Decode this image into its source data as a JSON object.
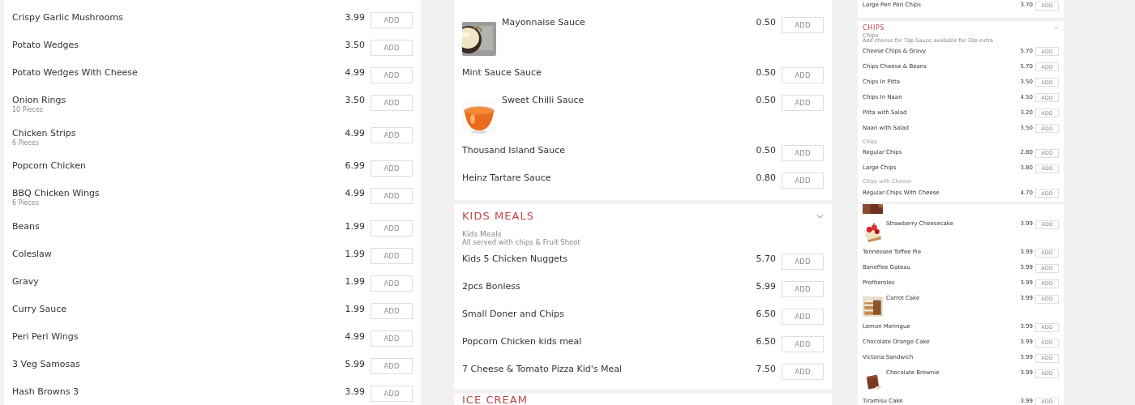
{
  "columns": [
    {
      "kind": "full",
      "sections": [
        {
          "items": [
            {
              "kind": "item",
              "name": "Crispy Garlic Mushrooms",
              "price": "3.99",
              "button": "ADD"
            },
            {
              "kind": "item",
              "name": "Potato Wedges",
              "price": "3.50",
              "button": "ADD"
            },
            {
              "kind": "item",
              "name": "Potato Wedges With Cheese",
              "price": "4.99",
              "button": "ADD"
            },
            {
              "kind": "item",
              "name": "Onion Rings",
              "sub": "10 Pieces",
              "price": "3.50",
              "button": "ADD"
            },
            {
              "kind": "item",
              "name": "Chicken Strips",
              "sub": "6 Pieces",
              "price": "4.99",
              "button": "ADD"
            },
            {
              "kind": "item",
              "name": "Popcorn Chicken",
              "price": "6.99",
              "button": "ADD"
            },
            {
              "kind": "item",
              "name": "BBQ Chicken Wings",
              "sub": "6 Pieces",
              "price": "4.99",
              "button": "ADD"
            },
            {
              "kind": "item",
              "name": "Beans",
              "price": "1.99",
              "button": "ADD"
            },
            {
              "kind": "item",
              "name": "Coleslaw",
              "price": "1.99",
              "button": "ADD"
            },
            {
              "kind": "item",
              "name": "Gravy",
              "price": "1.99",
              "button": "ADD"
            },
            {
              "kind": "item",
              "name": "Curry Sauce",
              "price": "1.99",
              "button": "ADD"
            },
            {
              "kind": "item",
              "name": "Peri Peri Wings",
              "price": "4.99",
              "button": "ADD"
            },
            {
              "kind": "item",
              "name": "3 Veg Samosas",
              "price": "5.99",
              "button": "ADD"
            },
            {
              "kind": "item",
              "name": "Hash Browns 3",
              "price": "3.99",
              "button": "ADD"
            }
          ]
        }
      ]
    },
    {
      "kind": "full",
      "sections": [
        {
          "items": [
            {
              "kind": "image_item",
              "name": "Mayonnaise Sauce",
              "price": "0.50",
              "button": "ADD"
            },
            {
              "kind": "item",
              "name": "Mint Sauce Sauce",
              "price": "0.50",
              "button": "ADD"
            },
            {
              "kind": "image_item",
              "name": "Sweet Chilli Sauce",
              "price": "0.50",
              "button": "ADD"
            },
            {
              "kind": "item",
              "name": "Thousand Island Sauce",
              "price": "0.50",
              "button": "ADD"
            },
            {
              "kind": "item",
              "name": "Heinz Tartare Sauce",
              "price": "0.80",
              "button": "ADD"
            }
          ]
        },
        {
          "title": "KIDS MEALS",
          "collapsible": true,
          "description": [
            "Kids Meals",
            "All served with chips & Fruit Shoot"
          ],
          "items": [
            {
              "kind": "item",
              "name": "Kids 5 Chicken Nuggets",
              "price": "5.70",
              "button": "ADD"
            },
            {
              "kind": "item",
              "name": "2pcs Bonless",
              "price": "5.99",
              "button": "ADD"
            },
            {
              "kind": "item",
              "name": "Small Doner and Chips",
              "price": "6.50",
              "button": "ADD"
            },
            {
              "kind": "item",
              "name": "Popcorn Chicken kids meal",
              "price": "6.50",
              "button": "ADD"
            },
            {
              "kind": "item",
              "name": "7 Cheese & Tomato Pizza Kid's Meal",
              "price": "7.50",
              "button": "ADD"
            }
          ]
        },
        {
          "title": "ICE CREAM"
        }
      ]
    },
    {
      "kind": "mini",
      "sections": [
        {
          "items": [
            {
              "kind": "item",
              "name": "Large Peri Peri Chips",
              "price": "3.70",
              "button": "ADD"
            }
          ]
        },
        {
          "title": "CHIPS",
          "collapsible": true,
          "description": [
            "Chips",
            "Add cheese for 70p Sauce available for 30p extra"
          ],
          "items": [
            {
              "kind": "item",
              "name": "Cheese Chips & Gravy",
              "price": "5.70",
              "button": "ADD"
            },
            {
              "kind": "item",
              "name": "Chips Cheese & Beans",
              "price": "5.70",
              "button": "ADD"
            },
            {
              "kind": "item",
              "name": "Chips In Pitta",
              "price": "3.50",
              "button": "ADD"
            },
            {
              "kind": "item",
              "name": "Chips In Naan",
              "price": "4.50",
              "button": "ADD"
            },
            {
              "kind": "item",
              "name": "Pitta with Salad",
              "price": "3.20",
              "button": "ADD"
            },
            {
              "kind": "item",
              "name": "Naan with Salad",
              "price": "3.50",
              "button": "ADD"
            },
            {
              "kind": "subheading",
              "name": "Chips"
            },
            {
              "kind": "item",
              "name": "Regular Chips",
              "price": "2.80",
              "button": "ADD"
            },
            {
              "kind": "item",
              "name": "Large Chips",
              "price": "3.80",
              "button": "ADD"
            },
            {
              "kind": "subheading",
              "name": "Chips with Cheese"
            },
            {
              "kind": "item",
              "name": "Regular Chips With Cheese",
              "price": "4.70",
              "button": "ADD"
            }
          ]
        },
        {
          "items": [
            {
              "kind": "image_only"
            },
            {
              "kind": "image_item",
              "name": "Strawberry Cheesecake",
              "price": "3.99",
              "button": "ADD"
            },
            {
              "kind": "item",
              "name": "Tennessee Toffee Pie",
              "price": "3.99",
              "button": "ADD"
            },
            {
              "kind": "item",
              "name": "Banoffee Gateau",
              "price": "3.99",
              "button": "ADD"
            },
            {
              "kind": "item",
              "name": "Profiteroles",
              "price": "3.99",
              "button": "ADD"
            },
            {
              "kind": "image_item",
              "name": "Carrot Cake",
              "price": "3.99",
              "button": "ADD"
            },
            {
              "kind": "item",
              "name": "Lemon Meringue",
              "price": "3.99",
              "button": "ADD"
            },
            {
              "kind": "item",
              "name": "Chocolate Orange Cake",
              "price": "3.99",
              "button": "ADD"
            },
            {
              "kind": "item",
              "name": "Victoria Sandwich",
              "price": "3.99",
              "button": "ADD"
            },
            {
              "kind": "image_item",
              "name": "Chocolate Brownie",
              "price": "3.99",
              "button": "ADD"
            },
            {
              "kind": "item",
              "name": "Tiramisu Cake",
              "price": "3.99",
              "button": "ADD"
            }
          ]
        }
      ]
    }
  ]
}
